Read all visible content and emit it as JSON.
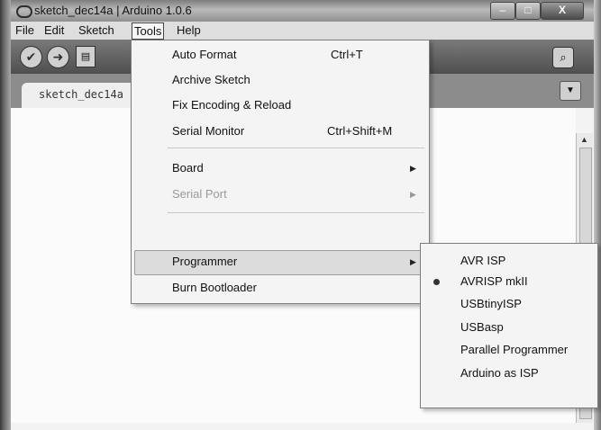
{
  "window": {
    "title": "sketch_dec14a | Arduino 1.0.6",
    "minimize_glyph": "–",
    "maximize_glyph": "□",
    "close_glyph": "X"
  },
  "menubar": {
    "items": [
      "File",
      "Edit",
      "Sketch",
      "Tools",
      "Help"
    ],
    "open_menu": "Tools"
  },
  "toolbar": {
    "verify_glyph": "✔",
    "upload_glyph": "➜",
    "new_glyph": "▤",
    "serial_monitor_glyph": "⌕"
  },
  "editor": {
    "tab_label": "sketch_dec14a",
    "tab_menu_glyph": "▼",
    "scroll_up_glyph": "▲"
  },
  "tools_menu": {
    "items": [
      {
        "label": "Auto Format",
        "shortcut": "Ctrl+T",
        "enabled": true
      },
      {
        "label": "Archive Sketch",
        "shortcut": "",
        "enabled": true
      },
      {
        "label": "Fix Encoding & Reload",
        "shortcut": "",
        "enabled": true
      },
      {
        "label": "Serial Monitor",
        "shortcut": "Ctrl+Shift+M",
        "enabled": true
      },
      {
        "label": "Board",
        "submenu": true,
        "enabled": true
      },
      {
        "label": "Serial Port",
        "submenu": true,
        "enabled": false
      },
      {
        "label": "Programmer",
        "submenu": true,
        "enabled": true,
        "highlighted": true
      },
      {
        "label": "Burn Bootloader",
        "shortcut": "",
        "enabled": true
      }
    ],
    "arrow_glyph": "▶"
  },
  "programmer_submenu": {
    "items": [
      "AVR ISP",
      "AVRISP mkII",
      "USBtinyISP",
      "USBasp",
      "Parallel Programmer",
      "Arduino as ISP"
    ],
    "selected": "AVRISP mkII"
  },
  "colors": {
    "menu_bg": "#f4f4f4",
    "highlight": "#dcdcdc",
    "disabled_text": "#9a9a9a"
  }
}
